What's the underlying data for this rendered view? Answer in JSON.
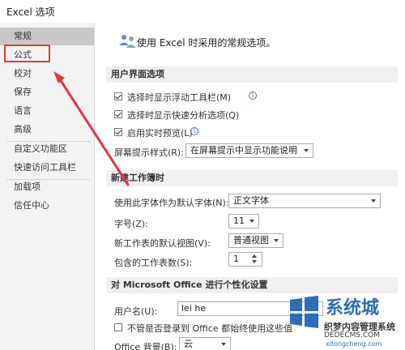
{
  "window": {
    "title": "Excel 选项"
  },
  "sidebar": {
    "items": [
      {
        "label": "常规"
      },
      {
        "label": "公式"
      },
      {
        "label": "校对"
      },
      {
        "label": "保存"
      },
      {
        "label": "语言"
      },
      {
        "label": "高级"
      },
      {
        "label": "自定义功能区"
      },
      {
        "label": "快速访问工具栏"
      },
      {
        "label": "加载项"
      },
      {
        "label": "信任中心"
      }
    ],
    "selected": "常规",
    "highlighted": "公式"
  },
  "main": {
    "header": "使用 Excel 时采用的常规选项。",
    "ui_options": {
      "section_title": "用户界面选项",
      "show_mini_toolbar": {
        "label": "选择时显示浮动工具栏(M)",
        "checked": true
      },
      "show_quick_analysis": {
        "label": "选择时显示快速分析选项(Q)",
        "checked": true
      },
      "live_preview": {
        "label": "启用实时预览(L)",
        "checked": true
      },
      "screentip_label": "屏幕提示样式(R):",
      "screentip_value": "在屏幕提示中显示功能说明"
    },
    "new_workbook": {
      "section_title": "新建工作簿时",
      "font_label": "使用此字体作为默认字体(N):",
      "font_value": "正文字体",
      "size_label": "字号(Z):",
      "size_value": "11",
      "view_label": "新工作表的默认视图(V):",
      "view_value": "普通视图",
      "sheets_label": "包含的工作表数(S):",
      "sheets_value": "1"
    },
    "personalize": {
      "section_title": "对 Microsoft Office 进行个性化设置",
      "username_label": "用户名(U):",
      "username_value": "lei he",
      "always_use_label": "不管是否登录到 Office 都始终使用这些值",
      "always_use_checked": false,
      "background_label": "Office 背景(B):",
      "background_value": "云"
    }
  },
  "watermark": {
    "brand": "系统城",
    "line2": "织梦内容管理系统",
    "line3": "DEDECMS.COM",
    "url": "xitongcheng.com"
  },
  "colors": {
    "annotation_red": "#e03a3a",
    "sidebar_bg": "#f3f3f3",
    "sidebar_selected": "#c8c8c8",
    "section_band": "#f0f0f0",
    "watermark_blue": "#2c6db5"
  }
}
